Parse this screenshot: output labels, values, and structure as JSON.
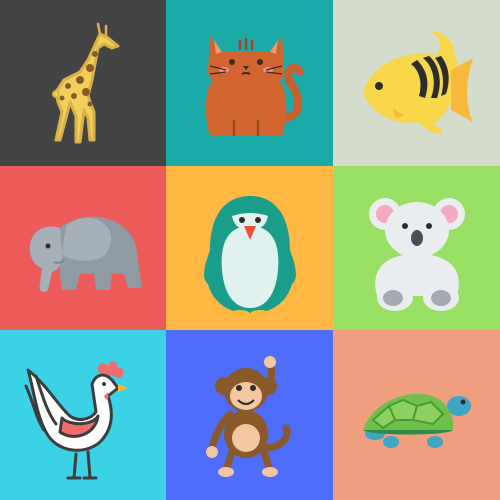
{
  "tiles": [
    {
      "animal": "giraffe",
      "bg": "#444444"
    },
    {
      "animal": "cat",
      "bg": "#1caaa8"
    },
    {
      "animal": "fish",
      "bg": "#d4dccb"
    },
    {
      "animal": "elephant",
      "bg": "#ee5b5b"
    },
    {
      "animal": "penguin",
      "bg": "#feb843"
    },
    {
      "animal": "koala",
      "bg": "#98e063"
    },
    {
      "animal": "rooster",
      "bg": "#3cd2e6"
    },
    {
      "animal": "monkey",
      "bg": "#4e6dfb"
    },
    {
      "animal": "turtle",
      "bg": "#ef9f7f"
    }
  ]
}
